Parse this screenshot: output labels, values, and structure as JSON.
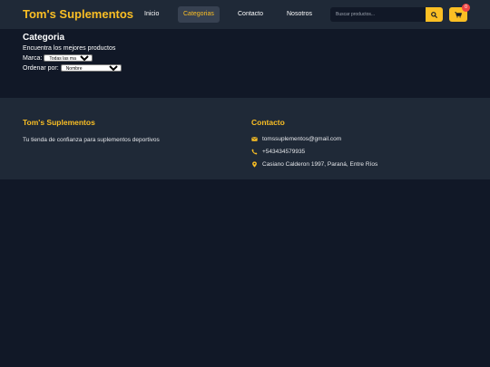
{
  "header": {
    "brand": "Tom's Suplementos",
    "nav": [
      {
        "label": "Inicio",
        "active": false
      },
      {
        "label": "Categorias",
        "active": true
      },
      {
        "label": "Contacto",
        "active": false
      },
      {
        "label": "Nosotros",
        "active": false
      }
    ],
    "search": {
      "placeholder": "Buscar productos..."
    },
    "search_icon": "search-icon",
    "cart_icon": "cart-icon",
    "cart_count": "0"
  },
  "main": {
    "title": "Categoria",
    "subtitle": "Encuentra los mejores productos",
    "brand_filter": {
      "label": "Marca:",
      "selected": "Todas las marcas"
    },
    "sort": {
      "label": "Ordenar por:",
      "selected": "Nombre"
    }
  },
  "footer": {
    "about": {
      "title": "Tom's Suplementos",
      "text": "Tu tienda de confianza para suplementos deportivos"
    },
    "contact": {
      "title": "Contacto",
      "items": [
        {
          "icon": "mail-icon",
          "text": "tomssuplementos@gmail.com"
        },
        {
          "icon": "phone-icon",
          "text": "+543434579935"
        },
        {
          "icon": "location-icon",
          "text": "Casiano Calderon 1997, Paraná, Entre Ríos"
        }
      ]
    }
  },
  "colors": {
    "accent": "#fbbf24",
    "background": "#111827",
    "header_bg": "#1f2937",
    "badge": "#ef4444"
  }
}
